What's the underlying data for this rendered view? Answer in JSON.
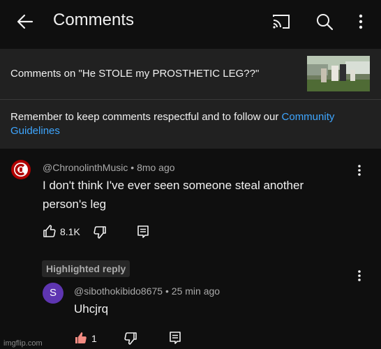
{
  "header": {
    "title": "Comments"
  },
  "video": {
    "caption": "Comments on \"He STOLE my PROSTHETIC LEG??\""
  },
  "notice": {
    "text": "Remember to keep comments respectful and to follow our ",
    "link": "Community Guidelines"
  },
  "comment": {
    "author": "@ChronolinthMusic",
    "time": "8mo ago",
    "separator": "•",
    "text": "I don't think I've ever seen someone steal another person's leg",
    "likes": "8.1K"
  },
  "highlight_label": "Highlighted reply",
  "reply": {
    "avatar_letter": "S",
    "author": "@sibothokibido8675",
    "time": "25 min ago",
    "separator": "•",
    "text": "Uhcjrq",
    "likes": "1"
  },
  "watermark": "imgflip.com",
  "colors": {
    "background": "#0f0f0f",
    "panel": "#212121",
    "link": "#3ea6ff",
    "reply_avatar": "#5e35b1",
    "liked": "#f28b82"
  }
}
